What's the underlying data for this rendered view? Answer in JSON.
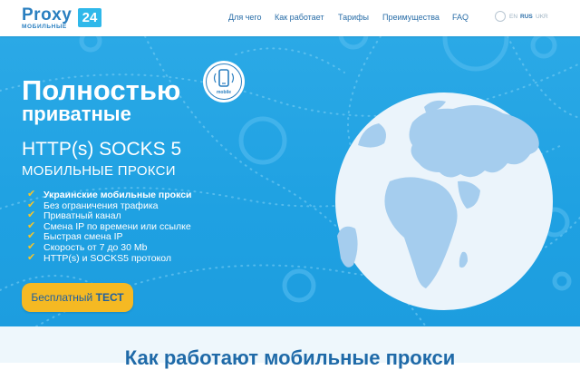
{
  "header": {
    "logo": {
      "word": "Proxy",
      "badge": "24",
      "subtitle": "МОБИЛЬНЫЕ"
    },
    "nav": [
      {
        "label": "Для чего"
      },
      {
        "label": "Как работает"
      },
      {
        "label": "Тарифы"
      },
      {
        "label": "Преимущества"
      },
      {
        "label": "FAQ"
      }
    ],
    "languages": [
      {
        "label": "EN",
        "active": false
      },
      {
        "label": "RUS",
        "active": true
      },
      {
        "label": "UKR",
        "active": false
      }
    ]
  },
  "hero": {
    "title_line1": "Полностью",
    "title_line2": "приватные",
    "protocols": "HTTP(s) SOCKS 5",
    "subtitle": "МОБИЛЬНЫЕ ПРОКСИ",
    "badge_caption": "mobile",
    "features": [
      "Украинские мобильные прокси",
      "Без ограничения трафика",
      "Приватный канал",
      "Смена IP по времени или ссылке",
      "Быстрая смена IP",
      "Скорость от 7 до 30 Mb",
      "HTTP(s) и SOCKS5 протокол"
    ],
    "cta": {
      "prefix": "Бесплатный",
      "emphasis": "ТЕСТ"
    }
  },
  "section2": {
    "title": "Как работают мобильные прокси"
  },
  "colors": {
    "hero_bg": "#24a4e4",
    "cta_bg": "#f5b923",
    "check": "#f5c528",
    "brand_blue": "#2a7fc0",
    "globe_water": "#e9f3fb",
    "globe_land": "#9cc7ea"
  }
}
